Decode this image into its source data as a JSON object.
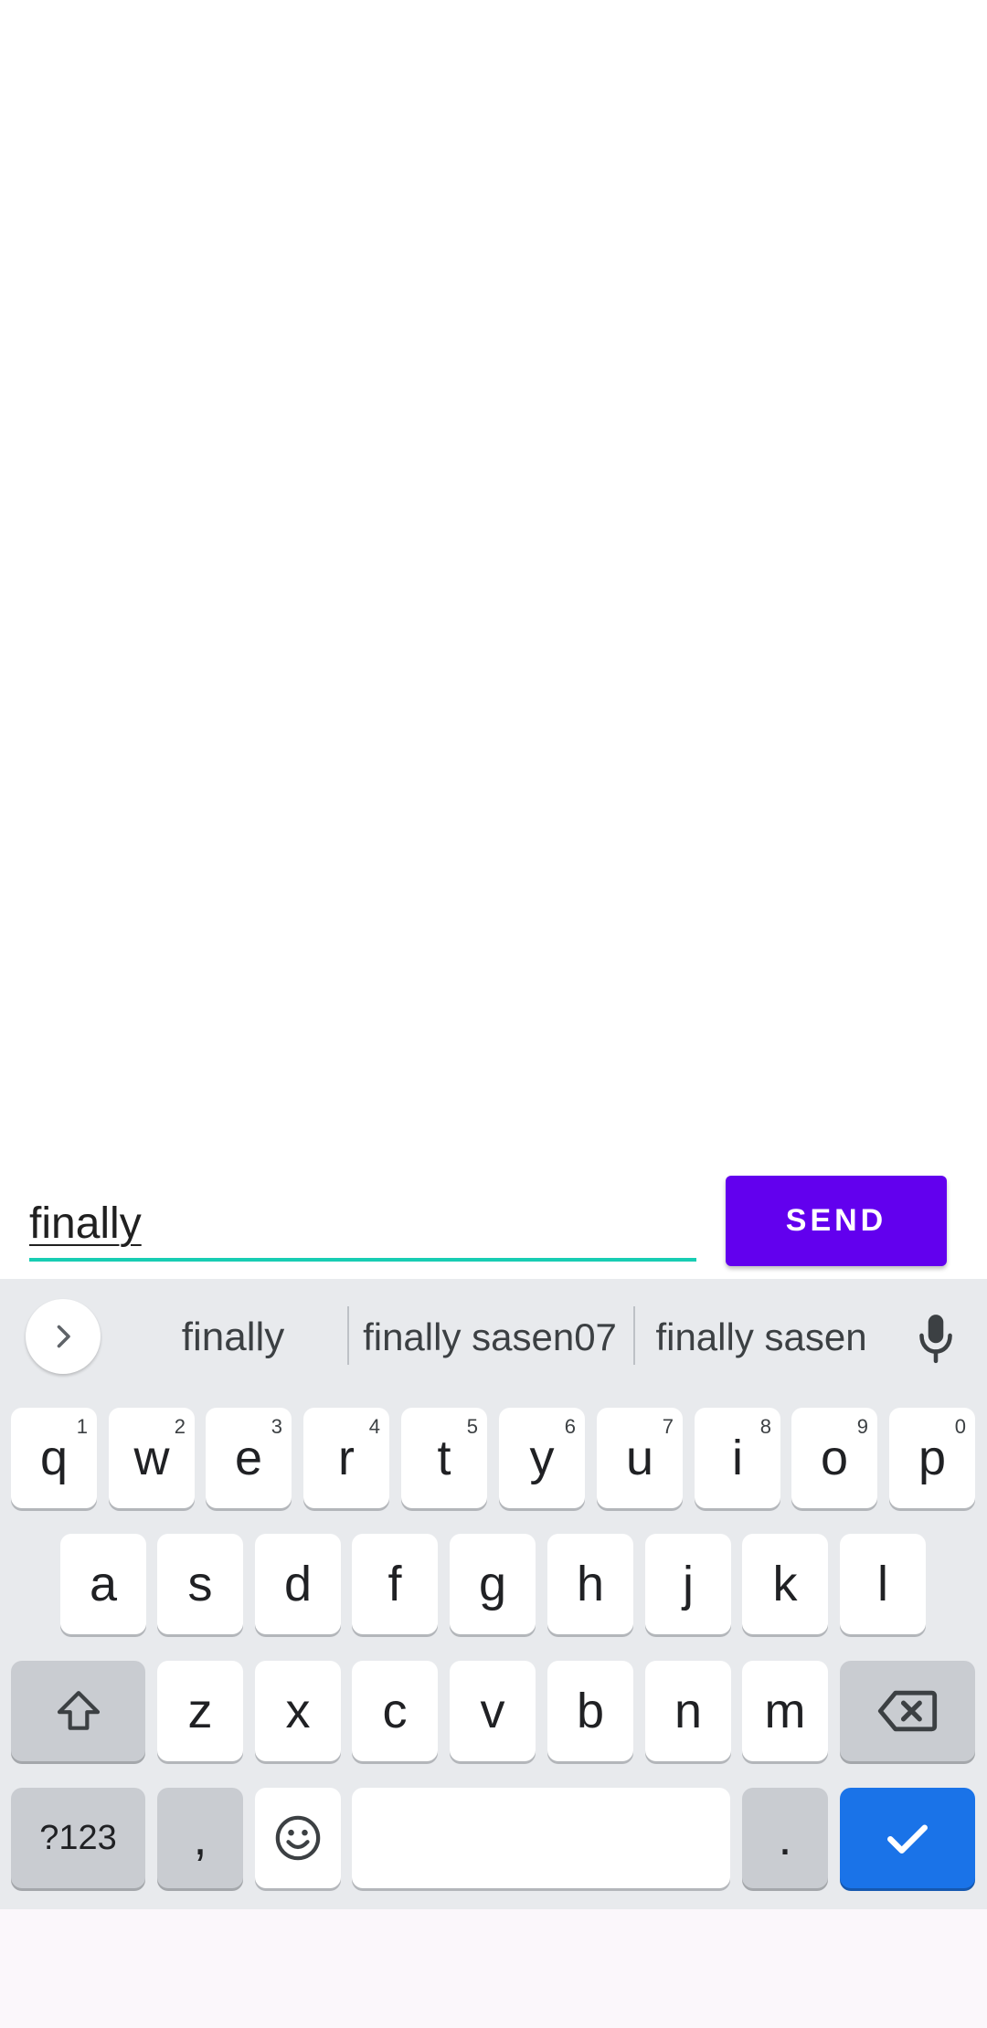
{
  "composer": {
    "input_value": "finally",
    "send_label": "SEND"
  },
  "keyboard": {
    "suggestions": [
      "finally",
      "finally sasen07",
      "finally sasen"
    ],
    "row1": [
      {
        "label": "q",
        "hint": "1"
      },
      {
        "label": "w",
        "hint": "2"
      },
      {
        "label": "e",
        "hint": "3"
      },
      {
        "label": "r",
        "hint": "4"
      },
      {
        "label": "t",
        "hint": "5"
      },
      {
        "label": "y",
        "hint": "6"
      },
      {
        "label": "u",
        "hint": "7"
      },
      {
        "label": "i",
        "hint": "8"
      },
      {
        "label": "o",
        "hint": "9"
      },
      {
        "label": "p",
        "hint": "0"
      }
    ],
    "row2": [
      "a",
      "s",
      "d",
      "f",
      "g",
      "h",
      "j",
      "k",
      "l"
    ],
    "row3": [
      "z",
      "x",
      "c",
      "v",
      "b",
      "n",
      "m"
    ],
    "symbols_label": "?123",
    "comma_label": ",",
    "period_label": ".",
    "icons": {
      "expand": "chevron-right-icon",
      "mic": "microphone-icon",
      "shift": "shift-icon",
      "backspace": "backspace-icon",
      "emoji": "emoji-icon",
      "enter": "checkmark-icon"
    },
    "colors": {
      "keyboard_bg": "#e8eaed",
      "enter_key": "#1a73e8",
      "send_button": "#6200ee",
      "field_underline": "#18cdb3"
    }
  }
}
